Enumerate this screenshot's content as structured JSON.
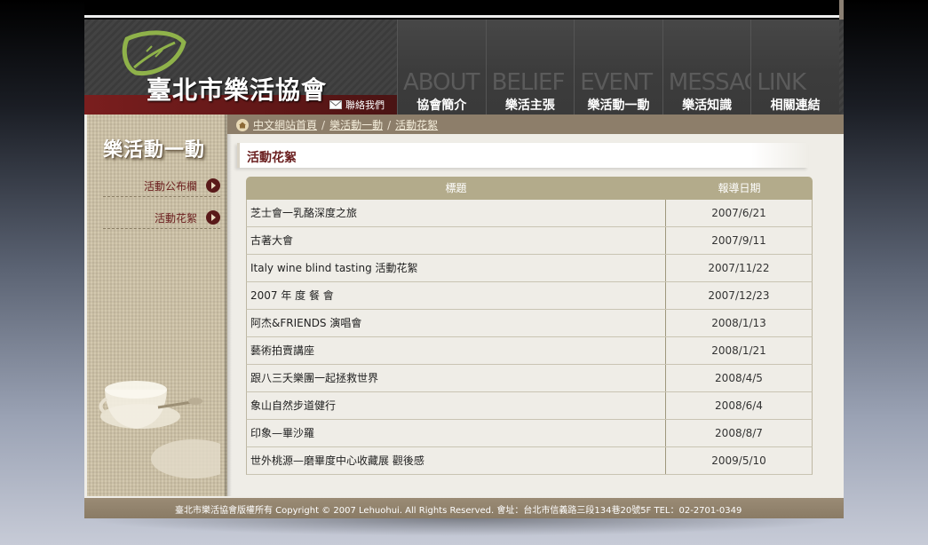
{
  "site": {
    "title": "臺北市樂活協會",
    "contact_label": "聯絡我們"
  },
  "nav": [
    {
      "ghost": "ABOUT",
      "label": "協會簡介"
    },
    {
      "ghost": "BELIEF",
      "label": "樂活主張"
    },
    {
      "ghost": "EVENT",
      "label": "樂活動一動"
    },
    {
      "ghost": "MESSAGE",
      "label": "樂活知識"
    },
    {
      "ghost": "LINK",
      "label": "相關連結"
    }
  ],
  "sidebar": {
    "title": "樂活動一動",
    "items": [
      {
        "label": "活動公布欄"
      },
      {
        "label": "活動花絮"
      }
    ]
  },
  "breadcrumb": {
    "items": [
      "中文網站首頁",
      "樂活動一動",
      "活動花絮"
    ],
    "separator": "/"
  },
  "main": {
    "heading": "活動花絮",
    "table": {
      "headers": [
        "標題",
        "報導日期"
      ],
      "rows": [
        {
          "title": "芝士會一乳酪深度之旅",
          "date": "2007/6/21"
        },
        {
          "title": "古著大會",
          "date": "2007/9/11"
        },
        {
          "title": "Italy wine blind tasting 活動花絮",
          "date": "2007/11/22"
        },
        {
          "title": "2007 年 度 餐 會",
          "date": "2007/12/23"
        },
        {
          "title": "阿杰&FRIENDS 演唱會",
          "date": "2008/1/13"
        },
        {
          "title": "藝術拍賣講座",
          "date": "2008/1/21"
        },
        {
          "title": "跟八三夭樂團一起拯救世界",
          "date": "2008/4/5"
        },
        {
          "title": "象山自然步道健行",
          "date": "2008/6/4"
        },
        {
          "title": "印象—畢沙羅",
          "date": "2008/8/7"
        },
        {
          "title": "世外桃源—磨畢度中心收藏展 觀後感",
          "date": "2009/5/10"
        }
      ]
    }
  },
  "footer": {
    "text": "臺北市樂活協會版權所有  Copyright © 2007 Lehuohui. All Rights Reserved. 會址：台北市信義路三段134巷20號5F   TEL：02-2701-0349"
  }
}
